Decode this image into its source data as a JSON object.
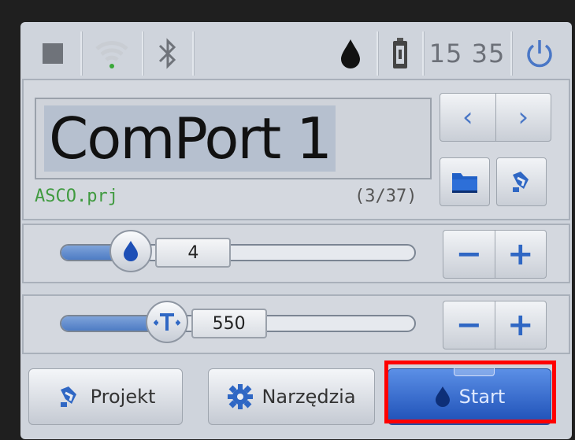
{
  "statusbar": {
    "clock": "15 35",
    "icons": [
      "stop-icon",
      "wifi-icon",
      "bluetooth-icon",
      "ink-drop-icon",
      "battery-icon",
      "power-icon"
    ]
  },
  "project": {
    "port_name": "ComPort 1",
    "file": "ASCO.prj",
    "counter": "(3/37)"
  },
  "sliders": [
    {
      "icon": "ink-drop-icon",
      "value": "4",
      "fill_fraction": 0.2
    },
    {
      "icon": "temperature-icon",
      "value": "550",
      "fill_fraction": 0.3
    }
  ],
  "bottom": {
    "project_label": "Projekt",
    "tools_label": "Narzędzia",
    "start_label": "Start"
  },
  "colors": {
    "accent": "#2f67c4",
    "start": "#1d4fb6",
    "file_text": "#3f9a3f",
    "highlight": "#ff0000"
  }
}
